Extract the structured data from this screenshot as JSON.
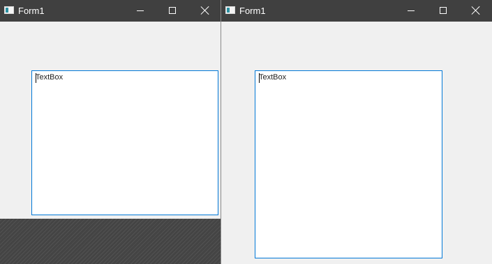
{
  "windows": [
    {
      "title": "Form1",
      "textbox": {
        "value": "TextBox"
      }
    },
    {
      "title": "Form1",
      "textbox": {
        "value": "TextBox"
      }
    }
  ],
  "controls": {
    "minimize": "minimize-icon",
    "maximize": "maximize-icon",
    "close": "close-icon"
  },
  "colors": {
    "titlebar": "#404040",
    "window_bg": "#f0f0f0",
    "textbox_border": "#0078d7",
    "textbox_bg": "#ffffff"
  }
}
